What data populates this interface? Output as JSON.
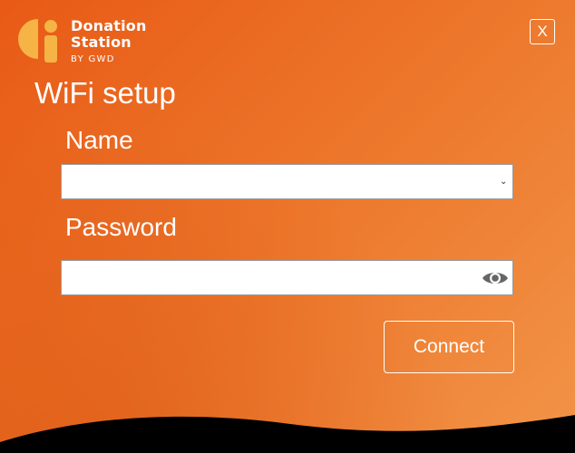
{
  "brand": {
    "name_line1": "Donation",
    "name_line2": "Station",
    "byline": "BY GWD",
    "logo_icon": "donation-station-logo-icon"
  },
  "window": {
    "close_label": "X",
    "title": "WiFi setup"
  },
  "form": {
    "name_label": "Name",
    "name_value": "",
    "password_label": "Password",
    "password_value": "",
    "reveal_icon": "eye-icon",
    "dropdown_icon": "chevron-down-icon",
    "connect_label": "Connect"
  },
  "colors": {
    "accent_orange": "#e96a20",
    "text": "#ffffff"
  }
}
